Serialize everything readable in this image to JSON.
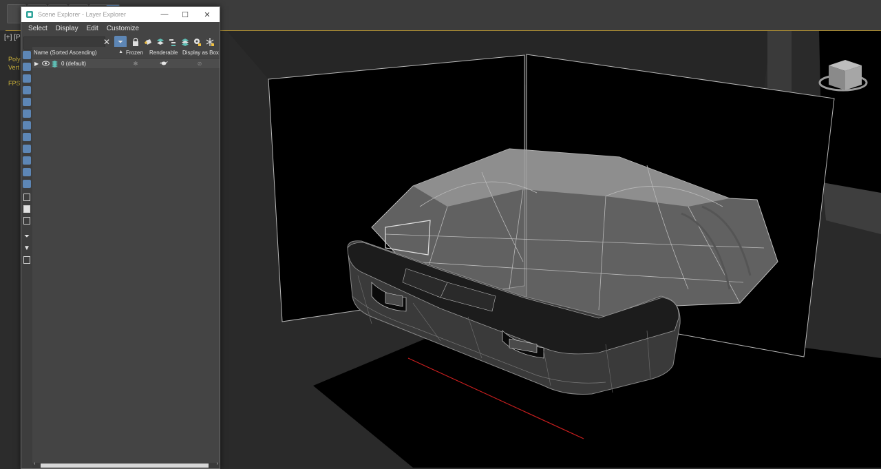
{
  "viewport": {
    "label": "[+] [P",
    "stats": [
      "Poly",
      "Vert",
      "FPS"
    ]
  },
  "scene_explorer": {
    "title": "Scene Explorer - Layer Explorer",
    "window_controls": {
      "minimize": "—",
      "maximize": "☐",
      "close": "✕"
    },
    "menu": [
      "Select",
      "Display",
      "Edit",
      "Customize"
    ],
    "search": {
      "value": "",
      "placeholder": ""
    },
    "columns": [
      "Name (Sorted Ascending)",
      "Frozen",
      "Renderable",
      "Display as Box"
    ],
    "sort_indicator": "▲",
    "rows": [
      {
        "name": "0 (default)",
        "frozen_icon": "snowflake-icon",
        "renderable_icon": "teapot-icon",
        "box_icon": "box-icon"
      }
    ]
  },
  "colors": {
    "accent": "#5d86b5",
    "selection_outline": "#b49332",
    "red_axis": "#c81e1e"
  }
}
